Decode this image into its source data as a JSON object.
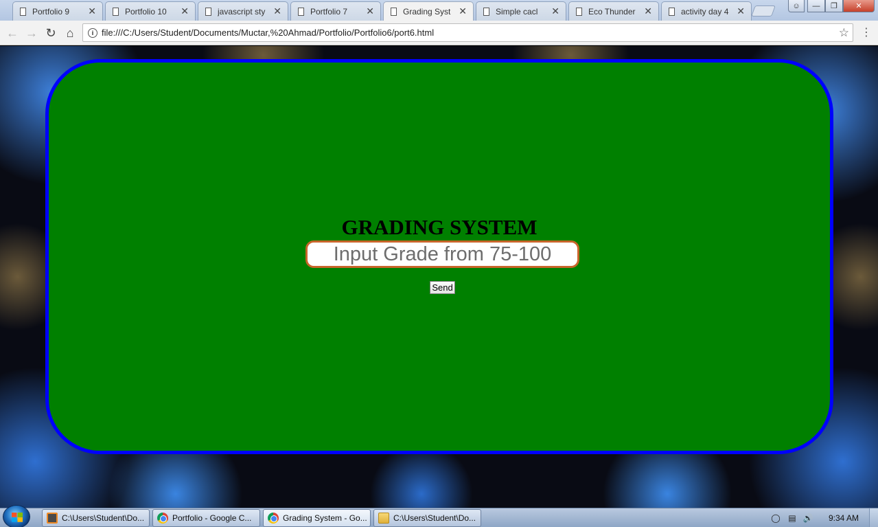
{
  "browser": {
    "tabs": [
      {
        "label": "Portfolio 9",
        "close": "✕"
      },
      {
        "label": "Portfolio 10",
        "close": "✕"
      },
      {
        "label": "javascript style",
        "close": "✕"
      },
      {
        "label": "Portfolio 7",
        "close": "✕"
      },
      {
        "label": "Grading System",
        "close": "✕"
      },
      {
        "label": "Simple cacl",
        "close": "✕"
      },
      {
        "label": "Eco Thunder P",
        "close": "✕"
      },
      {
        "label": "activity day 4",
        "close": "✕"
      }
    ],
    "address": "file:///C:/Users/Student/Documents/Muctar,%20Ahmad/Portfolio/Portfolio6/port6.html"
  },
  "page": {
    "heading": "GRADING SYSTEM",
    "input_placeholder": "Input Grade from 75-100",
    "send_label": "Send"
  },
  "taskbar": {
    "items": [
      {
        "label": "C:\\Users\\Student\\Do..."
      },
      {
        "label": "Portfolio - Google C..."
      },
      {
        "label": "Grading System - Go..."
      },
      {
        "label": "C:\\Users\\Student\\Do..."
      }
    ],
    "clock": "9:34 AM"
  },
  "colors": {
    "panel_fill": "#008000",
    "panel_border": "#0000ff",
    "input_border": "#c8652a"
  }
}
